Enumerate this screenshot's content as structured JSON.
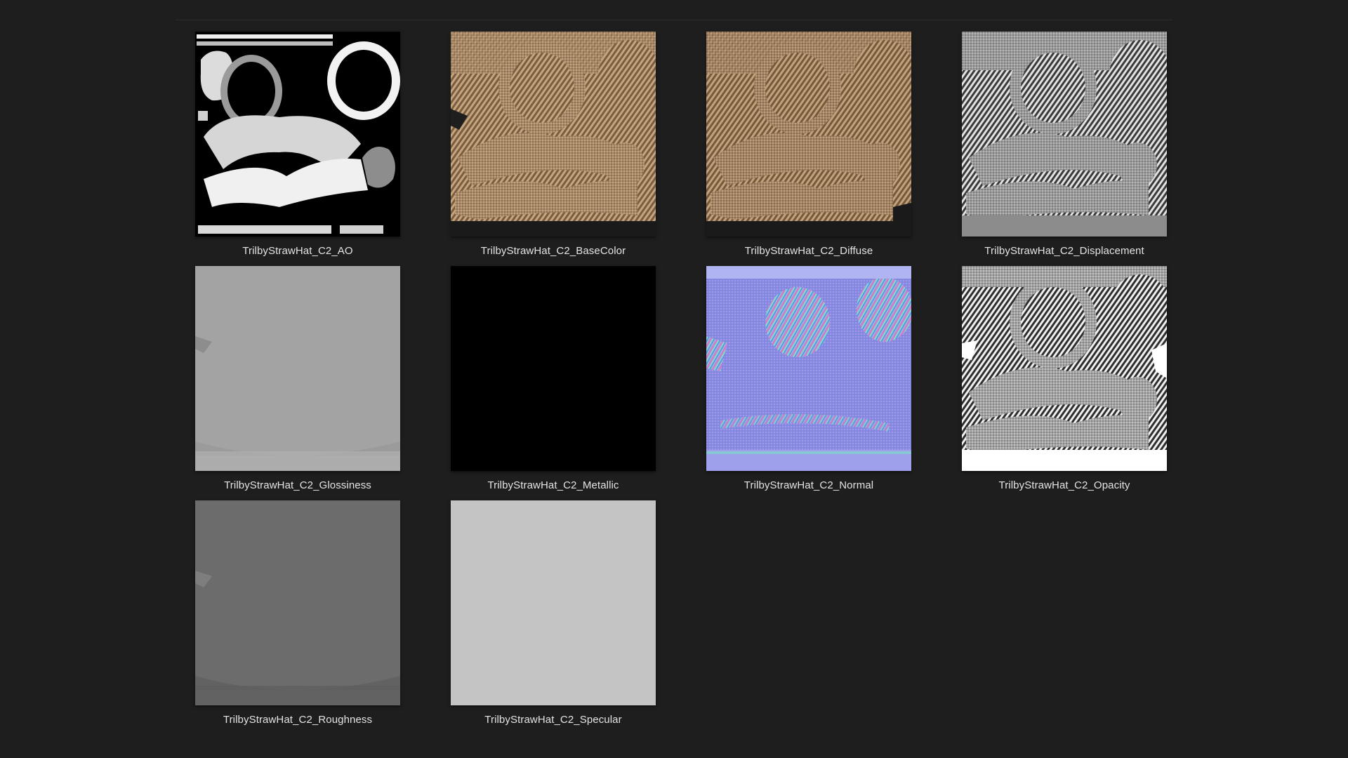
{
  "files": [
    {
      "name": "TrilbyStrawHat_C2_AO",
      "kind": "ao",
      "icon": "ao-map-thumbnail"
    },
    {
      "name": "TrilbyStrawHat_C2_BaseColor",
      "kind": "color",
      "icon": "basecolor-map-thumbnail"
    },
    {
      "name": "TrilbyStrawHat_C2_Diffuse",
      "kind": "color",
      "icon": "diffuse-map-thumbnail"
    },
    {
      "name": "TrilbyStrawHat_C2_Displacement",
      "kind": "gray-pattern",
      "icon": "displacement-map-thumbnail"
    },
    {
      "name": "TrilbyStrawHat_C2_Glossiness",
      "kind": "flat-light",
      "icon": "glossiness-map-thumbnail"
    },
    {
      "name": "TrilbyStrawHat_C2_Metallic",
      "kind": "black",
      "icon": "metallic-map-thumbnail"
    },
    {
      "name": "TrilbyStrawHat_C2_Normal",
      "kind": "normal",
      "icon": "normal-map-thumbnail"
    },
    {
      "name": "TrilbyStrawHat_C2_Opacity",
      "kind": "opacity",
      "icon": "opacity-map-thumbnail"
    },
    {
      "name": "TrilbyStrawHat_C2_Roughness",
      "kind": "flat-dark",
      "icon": "roughness-map-thumbnail"
    },
    {
      "name": "TrilbyStrawHat_C2_Specular",
      "kind": "flat-specular",
      "icon": "specular-map-thumbnail"
    }
  ],
  "colors": {
    "background": "#1e1e1e",
    "label": "#e4e4e4",
    "straw": "#a88a68",
    "straw_dark": "#6e5538",
    "normal_base": "#8a84e6",
    "gray_pattern": "#9a9a9a",
    "glossiness": "#a3a3a3",
    "roughness": "#6c6c6c",
    "specular": "#c4c4c4",
    "metallic": "#000000"
  }
}
